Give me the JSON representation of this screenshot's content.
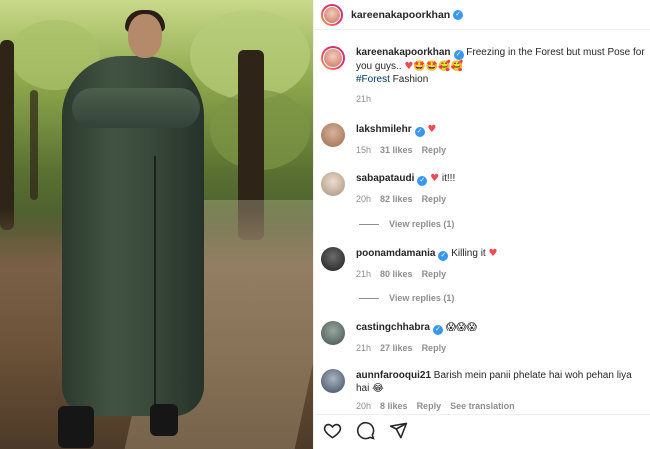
{
  "post": {
    "username": "kareenakapoorkhan",
    "caption": "Freezing in the Forest but must Pose for you guys..",
    "caption_emojis": "♥🤩🤩🥰🥰",
    "hashtag": "#Forest",
    "hashtag_rest": " Fashion",
    "time": "21h"
  },
  "comments": [
    {
      "username": "lakshmilehr",
      "text": "",
      "emoji": "♥",
      "time": "15h",
      "likes": "31 likes",
      "reply": "Reply"
    },
    {
      "username": "sabapataudi",
      "text": "it!!!",
      "emoji": "♥",
      "time": "20h",
      "likes": "82 likes",
      "reply": "Reply",
      "view_replies": "View replies (1)"
    },
    {
      "username": "poonamdamania",
      "text": "Killing it",
      "emoji": "♥",
      "time": "21h",
      "likes": "80 likes",
      "reply": "Reply",
      "view_replies": "View replies (1)"
    },
    {
      "username": "castingchhabra",
      "text": "",
      "emoji": "😱😱😱",
      "time": "21h",
      "likes": "27 likes",
      "reply": "Reply"
    },
    {
      "username": "aunnfarooqui21",
      "text": "Barish mein panii phelate hai woh pehan liya hai",
      "emoji": "😂",
      "time": "20h",
      "likes": "8 likes",
      "reply": "Reply",
      "see_translation": "See translation"
    }
  ],
  "icons": {
    "like": "heart-icon",
    "comment": "comment-icon",
    "share": "share-icon",
    "verified": "verified-badge-icon"
  },
  "colors": {
    "verified": "#3897f0",
    "heart": "#ed4956",
    "hashtag": "#00376b",
    "muted": "#8e8e8e"
  }
}
